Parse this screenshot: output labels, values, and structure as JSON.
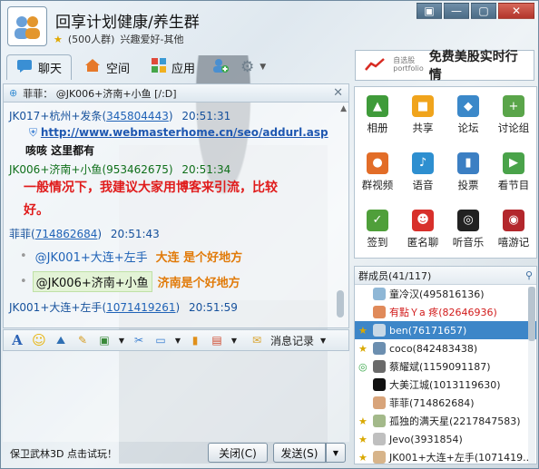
{
  "window": {
    "title": "回享计划健康/养生群",
    "member_count": "(500人群)",
    "tags": "兴趣爱好-其他",
    "controls": [
      "▣",
      "—",
      "▢",
      "✕"
    ]
  },
  "tabs": [
    {
      "label": "聊天",
      "icon": "chat-icon"
    },
    {
      "label": "空间",
      "icon": "home-icon"
    },
    {
      "label": "应用",
      "icon": "apps-icon"
    }
  ],
  "ad": {
    "logo_top": "自选股",
    "logo_bottom": "portfolio",
    "text": "免费美股实时行情"
  },
  "chat": {
    "header": "菲菲： @JK006+济南+小鱼 [/:D]",
    "messages": [
      {
        "name": "JK017+杭州+发条",
        "uid": "345804443",
        "time": "20:51:31",
        "kind": "other"
      },
      {
        "link": "http://www.webmasterhome.cn/seo/addurl.asp"
      },
      {
        "text": "咳咳 这里都有"
      },
      {
        "name": "JK006+济南+小鱼",
        "uid": "953462675",
        "time": "20:51:34",
        "kind": "self"
      },
      {
        "text_red_1": "一般情况下，我建议大家用博客来引流，比较",
        "text_red_2": "好。"
      },
      {
        "name": "菲菲",
        "uid": "714862684",
        "time": "20:51:43",
        "kind": "other"
      },
      {
        "mention": "@JK001+大连+左手",
        "text": "大连 是个好地方"
      },
      {
        "mention": "@JK006+济南+小鱼",
        "text": "济南是个好地方"
      },
      {
        "name": "JK001+大连+左手",
        "uid": "1071419261",
        "time": "20:51:59",
        "kind": "other"
      }
    ]
  },
  "input_toolbar": {
    "history_label": "消息记录"
  },
  "bottom": {
    "promo": "保卫武林3D 点击试玩！",
    "close_label": "关闭(C)",
    "send_label": "发送(S)"
  },
  "apps": [
    {
      "label": "相册",
      "color": "#3f9b3a",
      "glyph": "▲"
    },
    {
      "label": "共享",
      "color": "#f0a41c",
      "glyph": "■"
    },
    {
      "label": "论坛",
      "color": "#3b88c9",
      "glyph": "◆"
    },
    {
      "label": "讨论组",
      "color": "#5aa54a",
      "glyph": "+"
    },
    {
      "label": "群视频",
      "color": "#e26d28",
      "glyph": "●"
    },
    {
      "label": "语音",
      "color": "#2e8fd0",
      "glyph": "♪"
    },
    {
      "label": "投票",
      "color": "#3c7fc3",
      "glyph": "▮"
    },
    {
      "label": "看节目",
      "color": "#4aa34a",
      "glyph": "▶"
    },
    {
      "label": "签到",
      "color": "#4f9f3a",
      "glyph": "✓"
    },
    {
      "label": "匿名聊",
      "color": "#d8302b",
      "glyph": "☻"
    },
    {
      "label": "听音乐",
      "color": "#222222",
      "glyph": "◎"
    },
    {
      "label": "嘻游记",
      "color": "#b3272c",
      "glyph": "◉"
    }
  ],
  "members_panel": {
    "title": "群成员(41/117)",
    "members": [
      {
        "name": "童冷汉(495816136)",
        "star": false,
        "red": false
      },
      {
        "name": "有點Ｙa 疼(82646936)",
        "star": false,
        "red": true
      },
      {
        "name": "ben(76171657)",
        "star": true,
        "red": false,
        "selected": true
      },
      {
        "name": "coco(842483438)",
        "star": true,
        "red": false
      },
      {
        "name": "蔡耀斌(1159091187)",
        "star": false,
        "red": false
      },
      {
        "name": "大美江城(1013119630)",
        "star": false,
        "red": false
      },
      {
        "name": "菲菲(714862684)",
        "star": false,
        "red": false
      },
      {
        "name": "孤独的满天星(2217847583)",
        "star": true,
        "red": false
      },
      {
        "name": "Jevo(3931854)",
        "star": true,
        "red": false
      },
      {
        "name": "JK001+大连+左手(1071419...",
        "star": true,
        "red": false
      }
    ]
  }
}
